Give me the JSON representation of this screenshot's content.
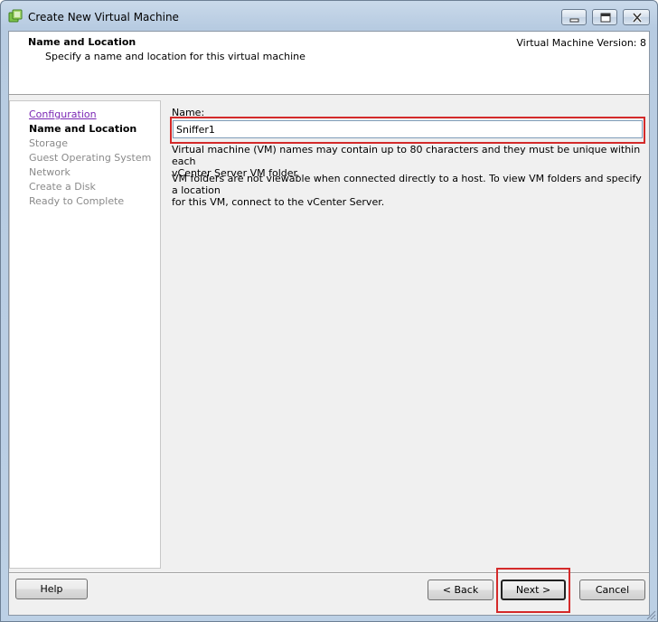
{
  "window": {
    "title": "Create New Virtual Machine",
    "icon": "vsphere-app-icon",
    "controls": [
      "minimize-icon",
      "maximize-icon",
      "close-icon"
    ]
  },
  "header": {
    "title": "Name and Location",
    "subtitle": "Specify a name and location for this virtual machine",
    "version": "Virtual Machine Version: 8"
  },
  "nav": {
    "items": [
      {
        "label": "Configuration",
        "state": "visited-link"
      },
      {
        "label": "Name and Location",
        "state": "current"
      },
      {
        "label": "Storage",
        "state": "disabled"
      },
      {
        "label": "Guest Operating System",
        "state": "disabled"
      },
      {
        "label": "Network",
        "state": "disabled"
      },
      {
        "label": "Create a Disk",
        "state": "disabled"
      },
      {
        "label": "Ready to Complete",
        "state": "disabled"
      }
    ]
  },
  "form": {
    "name_label": "Name:",
    "name_value": "Sniffer1",
    "info_1_line1": "Virtual machine (VM) names may contain up to 80 characters and they must be unique within each",
    "info_1_line2": "vCenter Server VM folder.",
    "info_2_line1": "VM folders are not viewable when connected directly to a host. To view VM folders and specify a location",
    "info_2_line2": "for this VM, connect to the vCenter Server."
  },
  "buttons": {
    "help": "Help",
    "back": "< Back",
    "next": "Next >",
    "cancel": "Cancel"
  },
  "colors": {
    "highlight": "#d42a2a",
    "link_visited": "#7a26b4",
    "disabled_text": "#8a8a8a"
  }
}
